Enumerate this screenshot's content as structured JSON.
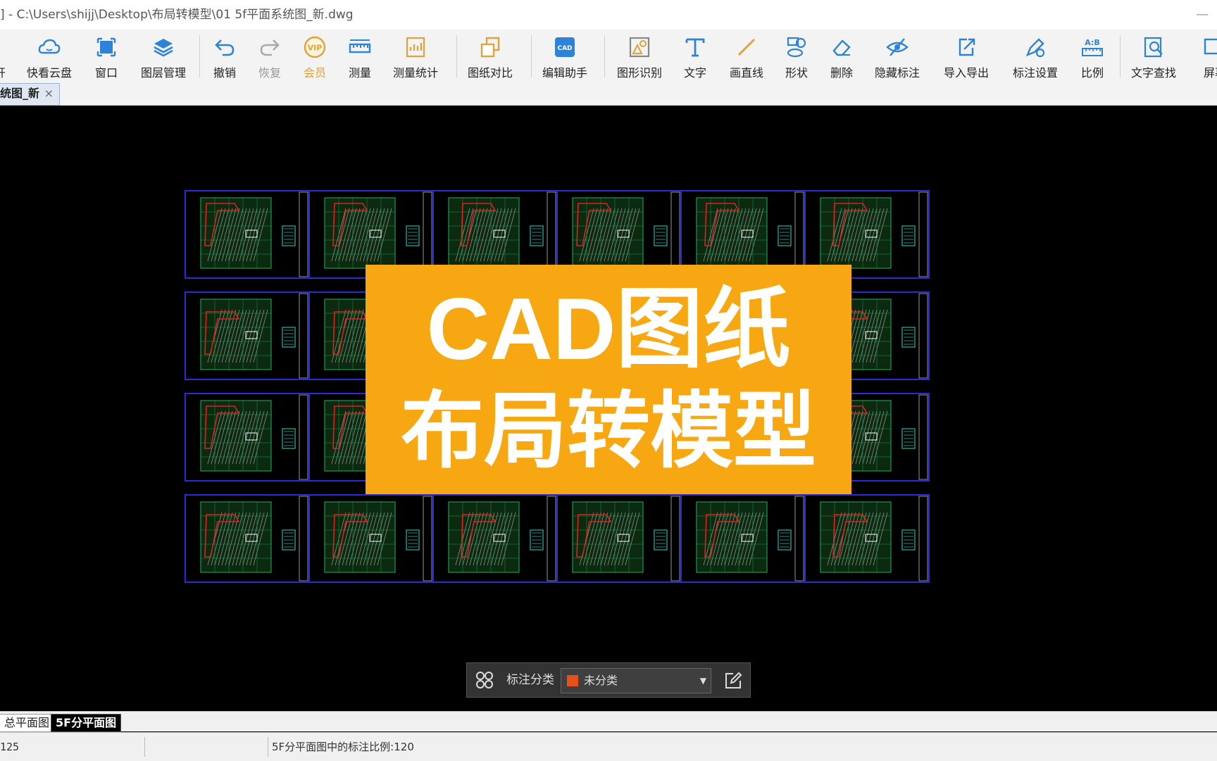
{
  "window": {
    "title": "] - C:\\Users\\shijj\\Desktop\\布局转模型\\01 5f平面系统图_新.dwg",
    "minimize": "—"
  },
  "toolbar": {
    "items": [
      {
        "label": "开",
        "icon": "open-icon"
      },
      {
        "label": "快看云盘",
        "icon": "cloud-icon"
      },
      {
        "label": "窗口",
        "icon": "window-icon"
      },
      {
        "label": "图层管理",
        "icon": "layers-icon"
      },
      {
        "label": "撤销",
        "icon": "undo-icon"
      },
      {
        "label": "恢复",
        "icon": "redo-icon"
      },
      {
        "label": "会员",
        "icon": "vip-icon"
      },
      {
        "label": "测量",
        "icon": "ruler-icon"
      },
      {
        "label": "测量统计",
        "icon": "measure-stats-icon"
      },
      {
        "label": "图纸对比",
        "icon": "compare-icon"
      },
      {
        "label": "编辑助手",
        "icon": "cad-edit-icon"
      },
      {
        "label": "图形识别",
        "icon": "shape-recognize-icon"
      },
      {
        "label": "文字",
        "icon": "text-icon"
      },
      {
        "label": "画直线",
        "icon": "line-icon"
      },
      {
        "label": "形状",
        "icon": "shapes-icon"
      },
      {
        "label": "删除",
        "icon": "eraser-icon"
      },
      {
        "label": "隐藏标注",
        "icon": "hide-eye-icon"
      },
      {
        "label": "导入导出",
        "icon": "import-export-icon"
      },
      {
        "label": "标注设置",
        "icon": "annotation-settings-icon"
      },
      {
        "label": "比例",
        "icon": "scale-icon"
      },
      {
        "label": "文字查找",
        "icon": "text-search-icon"
      },
      {
        "label": "屏幕",
        "icon": "screen-icon"
      }
    ],
    "vip_text": "VIP",
    "cad_text": "CAD",
    "scale_text": "A:B"
  },
  "document_tab": {
    "label": "统图_新",
    "close": "×"
  },
  "banner": {
    "line1": "CAD图纸",
    "line2": "布局转模型"
  },
  "annotation_bar": {
    "label": "标注分类",
    "selected": "未分类",
    "swatch_color": "#e8501a"
  },
  "layout_tabs": [
    {
      "label": "总平面图"
    },
    {
      "label": "5F分平面图"
    }
  ],
  "status": {
    "left": "125",
    "message": "5F分平面图中的标注比例:120"
  },
  "colors": {
    "accent_orange": "#f7a711",
    "frame_blue": "#2a2ad8",
    "plan_green": "#1f9a4a",
    "plan_red": "#e02020",
    "icon_blue": "#2d84d6"
  }
}
